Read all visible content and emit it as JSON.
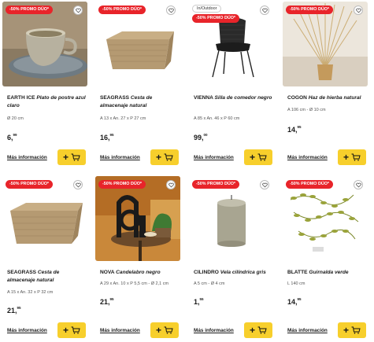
{
  "products": [
    {
      "badge": "-50% PROMO DÚO*",
      "name": "EARTH ICE",
      "desc": "Plato de postre azul claro",
      "dims": "Ø 20 cm",
      "price_int": "6,",
      "price_dec": "99",
      "more": "Más información"
    },
    {
      "badge": "-50% PROMO DÚO*",
      "name": "SEAGRASS",
      "desc": "Cesta de almacenaje natural",
      "dims": "A 13 x An. 27 x P 27 cm",
      "price_int": "16,",
      "price_dec": "95",
      "more": "Más información"
    },
    {
      "badge_top": "In/Outdoor",
      "badge": "-50% PROMO DÚO*",
      "name": "VIENNA",
      "desc": "Silla de comedor negro",
      "dims": "A 85 x An. 46 x P 60 cm",
      "price_int": "99,",
      "price_dec": "00",
      "more": "Más información"
    },
    {
      "badge": "-50% PROMO DÚO*",
      "name": "COGON",
      "desc": "Haz de hierba natural",
      "dims": "A 106 cm - Ø 10 cm",
      "price_int": "14,",
      "price_dec": "95",
      "more": "Más información"
    },
    {
      "badge": "-50% PROMO DÚO*",
      "name": "SEAGRASS",
      "desc": "Cesta de almacenaje natural",
      "dims": "A 15 x An. 32 x P 32 cm",
      "price_int": "21,",
      "price_dec": "95",
      "more": "Más información"
    },
    {
      "badge": "-50% PROMO DÚO*",
      "name": "NOVA",
      "desc": "Candelabro negro",
      "dims": "A 29 x An. 10 x P 5,5 cm - Ø 2,1 cm",
      "price_int": "21,",
      "price_dec": "95",
      "more": "Más información"
    },
    {
      "badge": "-50% PROMO DÚO*",
      "name": "CILINDRO",
      "desc": "Vela cilíndrica gris",
      "dims": "A 5 cm - Ø 4 cm",
      "price_int": "1,",
      "price_dec": "55",
      "more": "Más información"
    },
    {
      "badge": "-50% PROMO DÚO*",
      "name": "BLATTE",
      "desc": "Guirnalda verde",
      "dims": "L 140 cm",
      "price_int": "14,",
      "price_dec": "95",
      "more": "Más información"
    }
  ],
  "icons": {
    "favorite": "heart-icon",
    "cart": "cart-icon"
  },
  "colors": {
    "badge": "#e8242a",
    "cart_button": "#f7cf2c"
  },
  "cart_plus": "+"
}
